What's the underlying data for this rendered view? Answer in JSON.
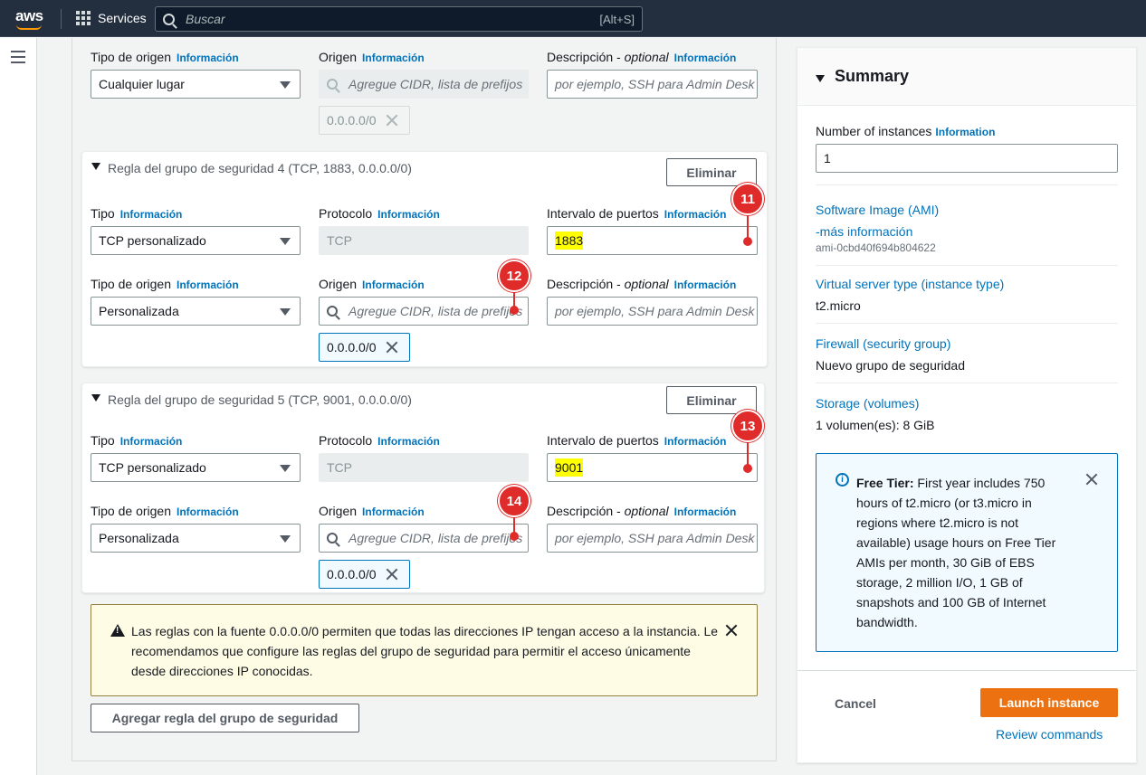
{
  "topnav": {
    "logo_text": "aws",
    "services_label": "Services",
    "search_placeholder": "Buscar",
    "search_shortcut": "[Alt+S]"
  },
  "rule_top": {
    "origin_type_label": "Tipo de origen",
    "origin_type_value": "Cualquier lugar",
    "origin_label": "Origen",
    "origin_placeholder": "Agregue CIDR, lista de prefijos",
    "origin_token": "0.0.0.0/0",
    "desc_label": "Descripción - ",
    "desc_optional": "optional",
    "desc_placeholder": "por ejemplo, SSH para Admin Desk"
  },
  "info_link": "Información",
  "rules": [
    {
      "title": "Regla del grupo de seguridad 4 (TCP, 1883, 0.0.0.0/0)",
      "delete_label": "Eliminar",
      "type_label": "Tipo",
      "type_value": "TCP personalizado",
      "protocol_label": "Protocolo",
      "protocol_value": "TCP",
      "port_label": "Intervalo de puertos",
      "port_value": "1883",
      "origin_type_label": "Tipo de origen",
      "origin_type_value": "Personalizada",
      "origin_label": "Origen",
      "origin_placeholder": "Agregue CIDR, lista de prefijos",
      "origin_token": "0.0.0.0/0",
      "desc_label": "Descripción - ",
      "desc_optional": "optional",
      "desc_placeholder": "por ejemplo, SSH para Admin Desk",
      "marker_port": "11",
      "marker_origin": "12"
    },
    {
      "title": "Regla del grupo de seguridad 5 (TCP, 9001, 0.0.0.0/0)",
      "delete_label": "Eliminar",
      "type_label": "Tipo",
      "type_value": "TCP personalizado",
      "protocol_label": "Protocolo",
      "protocol_value": "TCP",
      "port_label": "Intervalo de puertos",
      "port_value": "9001",
      "origin_type_label": "Tipo de origen",
      "origin_type_value": "Personalizada",
      "origin_label": "Origen",
      "origin_placeholder": "Agregue CIDR, lista de prefijos",
      "origin_token": "0.0.0.0/0",
      "desc_label": "Descripción - ",
      "desc_optional": "optional",
      "desc_placeholder": "por ejemplo, SSH para Admin Desk",
      "marker_port": "13",
      "marker_origin": "14"
    }
  ],
  "warning": {
    "text": "Las reglas con la fuente 0.0.0.0/0 permiten que todas las direcciones IP tengan acceso a la instancia. Le recomendamos que configure las reglas del grupo de seguridad para permitir el acceso únicamente desde direcciones IP conocidas."
  },
  "add_rule_label": "Agregar regla del grupo de seguridad",
  "summary": {
    "title": "Summary",
    "instances_label": "Number of instances",
    "instances_info": "Information",
    "instances_value": "1",
    "ami_link": "Software Image (AMI)",
    "ami_more": "-más información",
    "ami_id": "ami-0cbd40f694b804622",
    "instance_type_link": "Virtual server type (instance type)",
    "instance_type_value": "t2.micro",
    "firewall_link": "Firewall (security group)",
    "firewall_value": "Nuevo grupo de seguridad",
    "storage_link": "Storage (volumes)",
    "storage_value": "1 volumen(es): 8 GiB",
    "free_tier_bold": "Free Tier:",
    "free_tier_text": " First year includes 750 hours of t2.micro (or t3.micro in regions where t2.micro is not available) usage hours on Free Tier AMIs per month, 30 GiB of EBS storage, 2 million I/O, 1 GB of snapshots and 100 GB of Internet bandwidth.",
    "cancel_label": "Cancel",
    "launch_label": "Launch instance",
    "review_label": "Review commands"
  },
  "colors": {
    "nav_bg": "#232f3e",
    "link": "#0073bb",
    "primary_btn": "#ec7211",
    "marker": "#e02b2b",
    "highlight": "#ffff00"
  }
}
